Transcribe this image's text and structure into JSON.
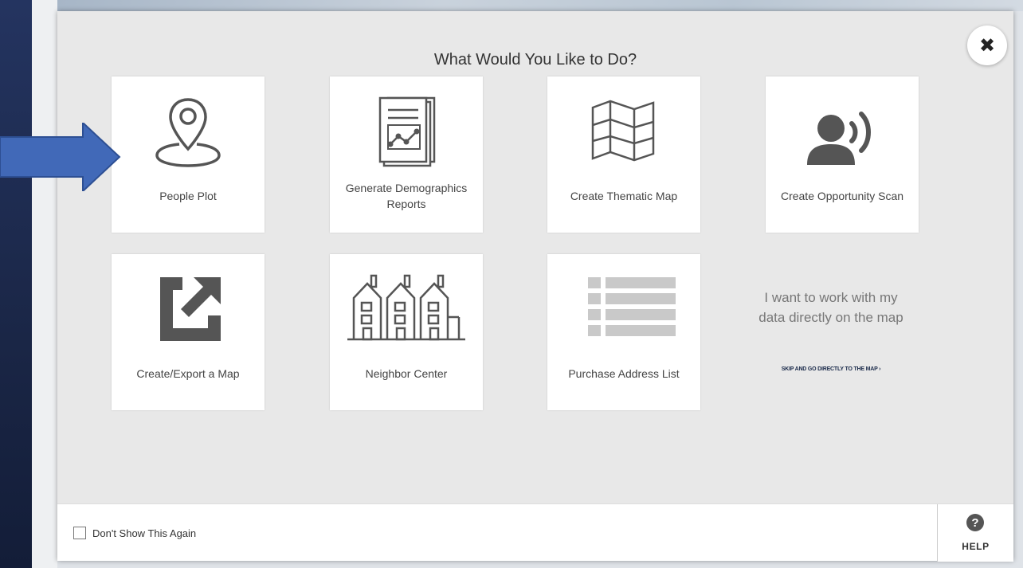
{
  "modal": {
    "title": "What Would You Like to Do?",
    "close_icon": "close-icon"
  },
  "cards": [
    {
      "label": "People Plot",
      "icon": "map-pin-icon"
    },
    {
      "label": "Generate Demographics Reports",
      "icon": "report-chart-icon"
    },
    {
      "label": "Create Thematic Map",
      "icon": "folded-map-icon"
    },
    {
      "label": "Create Opportunity Scan",
      "icon": "person-broadcast-icon"
    },
    {
      "label": "Create/Export a Map",
      "icon": "export-icon"
    },
    {
      "label": "Neighbor Center",
      "icon": "townhouses-icon"
    },
    {
      "label": "Purchase Address List",
      "icon": "list-icon"
    }
  ],
  "side_note": {
    "text": "I want to work with my data directly on the map",
    "skip_link": "SKIP AND GO DIRECTLY TO THE MAP ›"
  },
  "footer": {
    "dont_show_label": "Don't Show This Again",
    "dont_show_checked": false,
    "help_label": "HELP",
    "help_glyph": "?"
  },
  "colors": {
    "arrow": "#4169b8",
    "icon_gray": "#555555"
  }
}
